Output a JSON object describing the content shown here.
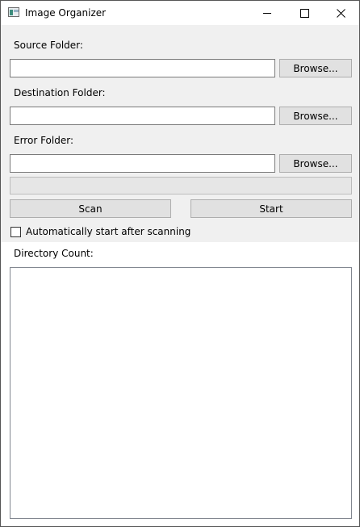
{
  "window": {
    "title": "Image Organizer",
    "icon": "app-image-icon",
    "controls": {
      "minimize_icon": "minimize-icon",
      "maximize_icon": "maximize-icon",
      "close_icon": "close-icon"
    }
  },
  "form": {
    "source_label": "Source Folder:",
    "source_value": "",
    "destination_label": "Destination Folder:",
    "destination_value": "",
    "error_label": "Error Folder:",
    "error_value": "",
    "browse_label": "Browse...",
    "progress_percent": 0,
    "scan_label": "Scan",
    "start_label": "Start",
    "auto_start_label": "Automatically start after scanning",
    "auto_start_checked": false,
    "directory_count_label": "Directory Count:",
    "directory_items": []
  },
  "colors": {
    "panel_background": "#f0f0f0",
    "button_background": "#e1e1e1",
    "progress_fill": "#06b025"
  }
}
